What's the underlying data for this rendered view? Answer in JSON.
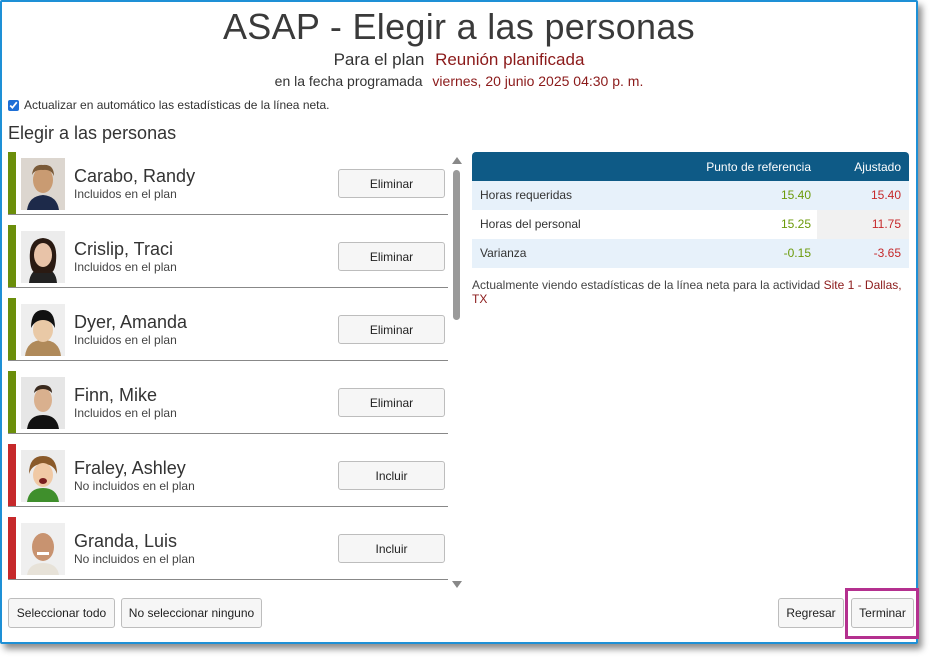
{
  "title": "ASAP - Elegir a las personas",
  "plan": {
    "label": "Para el plan",
    "value": "Reunión planificada"
  },
  "date": {
    "label": "en la fecha programada",
    "value": "viernes, 20 junio 2025 04:30 p. m."
  },
  "auto_update": {
    "label": "Actualizar en automático las estadísticas de la línea neta.",
    "checked": true
  },
  "section_title": "Elegir a las personas",
  "people": [
    {
      "name": "Carabo, Randy",
      "status": "Incluidos en el plan",
      "included": true,
      "button": "Eliminar"
    },
    {
      "name": "Crislip, Traci",
      "status": "Incluidos en el plan",
      "included": true,
      "button": "Eliminar"
    },
    {
      "name": "Dyer, Amanda",
      "status": "Incluidos en el plan",
      "included": true,
      "button": "Eliminar"
    },
    {
      "name": "Finn, Mike",
      "status": "Incluidos en el plan",
      "included": true,
      "button": "Eliminar"
    },
    {
      "name": "Fraley, Ashley",
      "status": "No incluidos en el plan",
      "included": false,
      "button": "Incluir"
    },
    {
      "name": "Granda, Luis",
      "status": "No incluidos en el plan",
      "included": false,
      "button": "Incluir"
    }
  ],
  "stats": {
    "headers": {
      "reference": "Punto de referencia",
      "adjusted": "Ajustado"
    },
    "rows": [
      {
        "label": "Horas requeridas",
        "reference": "15.40",
        "adjusted": "15.40"
      },
      {
        "label": "Horas del personal",
        "reference": "15.25",
        "adjusted": "11.75"
      },
      {
        "label": "Varianza",
        "reference": "-0.15",
        "adjusted": "-3.65"
      }
    ]
  },
  "note": {
    "text": "Actualmente viendo estadísticas de la línea neta para la actividad",
    "location": "Site 1 - Dallas, TX"
  },
  "footer": {
    "select_all": "Seleccionar todo",
    "select_none": "No seleccionar ninguno",
    "back": "Regresar",
    "finish": "Terminar"
  },
  "colors": {
    "included": "#6b8e0a",
    "excluded": "#c6292b",
    "header_bg": "#0e5a86",
    "accent_text": "#8b1a1a",
    "highlight": "#b4308f"
  }
}
